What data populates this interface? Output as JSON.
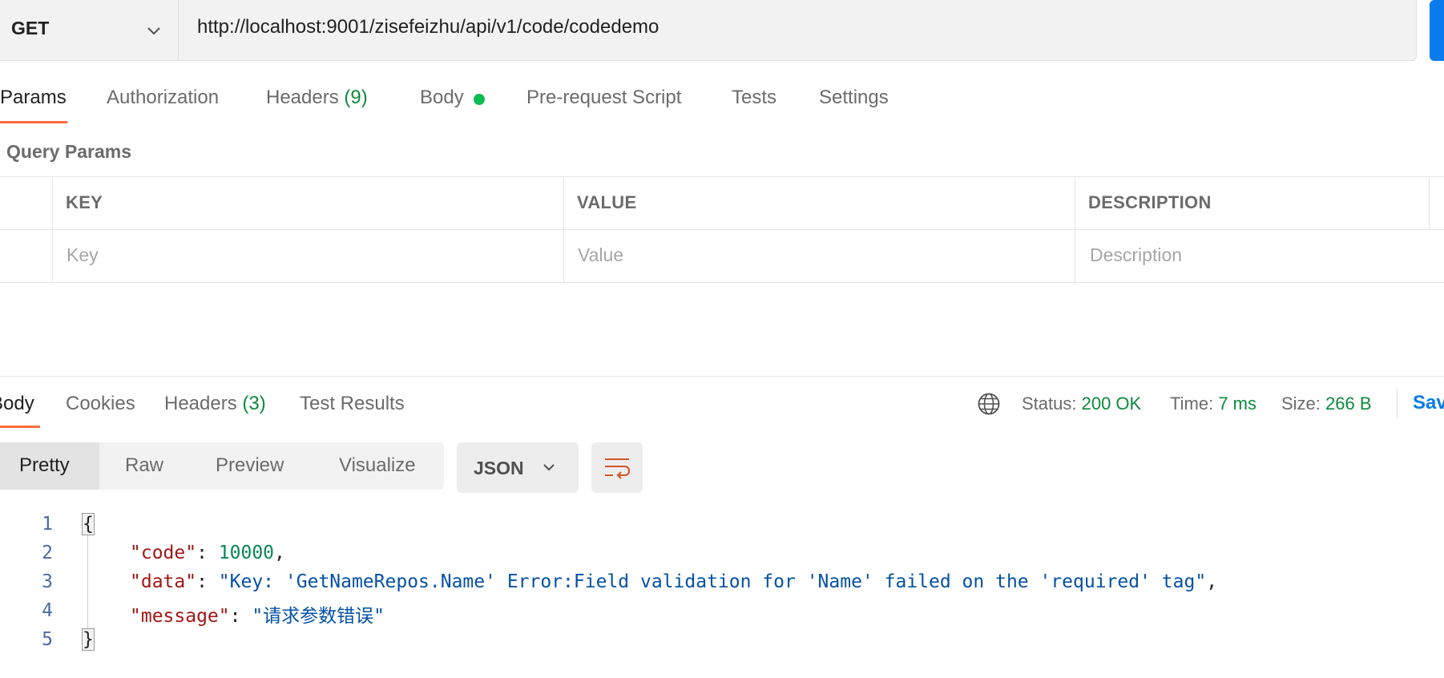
{
  "request": {
    "method": "GET",
    "url": "http://localhost:9001/zisefeizhu/api/v1/code/codedemo"
  },
  "request_tabs": {
    "params": "Params",
    "authorization": "Authorization",
    "headers": "Headers",
    "headers_count": "(9)",
    "body": "Body",
    "pre_request": "Pre-request Script",
    "tests": "Tests",
    "settings": "Settings"
  },
  "query_params": {
    "title": "Query Params",
    "columns": [
      "KEY",
      "VALUE",
      "DESCRIPTION"
    ],
    "placeholders": [
      "Key",
      "Value",
      "Description"
    ]
  },
  "response_tabs": {
    "body": "Body",
    "cookies": "Cookies",
    "headers": "Headers",
    "headers_count": "(3)",
    "test_results": "Test Results"
  },
  "response_meta": {
    "status_label": "Status:",
    "status_value": "200 OK",
    "time_label": "Time:",
    "time_value": "7 ms",
    "size_label": "Size:",
    "size_value": "266 B",
    "save_label": "Sav"
  },
  "format": {
    "options": [
      "Pretty",
      "Raw",
      "Preview",
      "Visualize"
    ],
    "active": "Pretty",
    "language": "JSON"
  },
  "response_body": {
    "line_numbers": [
      "1",
      "2",
      "3",
      "4",
      "5"
    ],
    "open_brace": "{",
    "close_brace": "}",
    "code_key": "\"code\"",
    "code_value": "10000",
    "data_key": "\"data\"",
    "data_value": "\"Key: 'GetNameRepos.Name' Error:Field validation for 'Name' failed on the 'required' tag\"",
    "message_key": "\"message\"",
    "message_value": "\"请求参数错误\""
  },
  "colors": {
    "accent": "#ff6c37",
    "success": "#0d8a3d",
    "link": "#097bed"
  },
  "icons": [
    "chevron-down-icon",
    "globe-icon",
    "wrap-lines-icon"
  ]
}
